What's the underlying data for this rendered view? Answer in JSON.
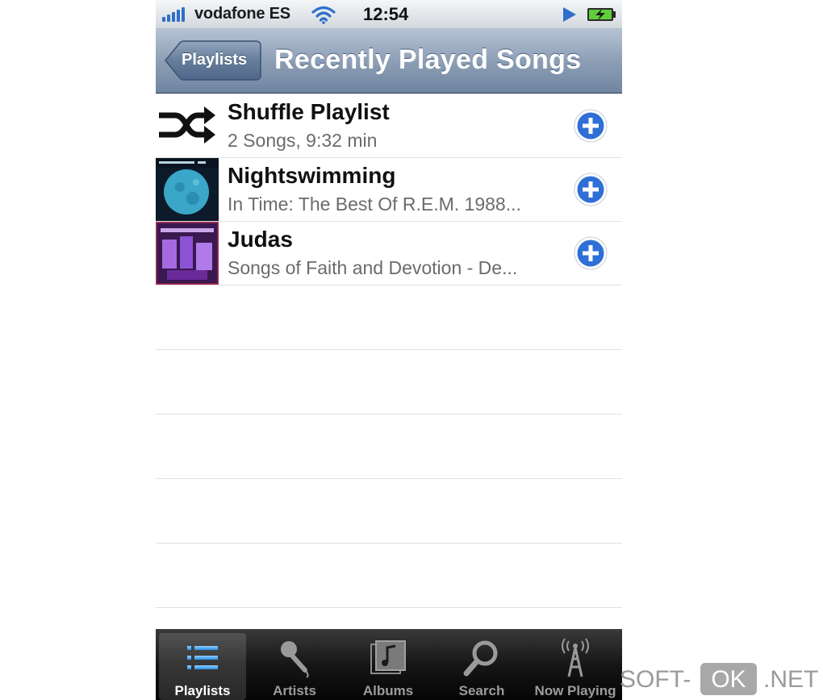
{
  "status_bar": {
    "carrier": "vodafone ES",
    "time": "12:54",
    "signal_bars": 5,
    "icons": [
      "signal-icon",
      "wifi-icon",
      "play-icon",
      "battery-charging-icon"
    ]
  },
  "nav_bar": {
    "back_label": "Playlists",
    "title": "Recently Played Songs"
  },
  "songs": [
    {
      "title": "Shuffle Playlist",
      "subtitle": "2 Songs, 9:32 min",
      "icon": "shuffle-icon"
    },
    {
      "title": "Nightswimming",
      "subtitle": "In Time: The Best Of R.E.M. 1988...",
      "icon": "album-art"
    },
    {
      "title": "Judas",
      "subtitle": "Songs of Faith and Devotion - De...",
      "icon": "album-art"
    }
  ],
  "tab_bar": {
    "tabs": [
      {
        "label": "Playlists",
        "icon": "playlists-icon",
        "active": true
      },
      {
        "label": "Artists",
        "icon": "microphone-icon",
        "active": false
      },
      {
        "label": "Albums",
        "icon": "albums-icon",
        "active": false
      },
      {
        "label": "Search",
        "icon": "search-icon",
        "active": false
      },
      {
        "label": "Now Playing",
        "icon": "now-playing-icon",
        "active": false
      }
    ]
  },
  "watermark": {
    "part1": "SOFT-",
    "part2": "OK",
    "part3": ".NET"
  },
  "colors": {
    "nav_bar": "#8d9fb6",
    "add_button": "#2f6fd6",
    "tab_bar": "#161616",
    "signal": "#2f6fc9"
  }
}
